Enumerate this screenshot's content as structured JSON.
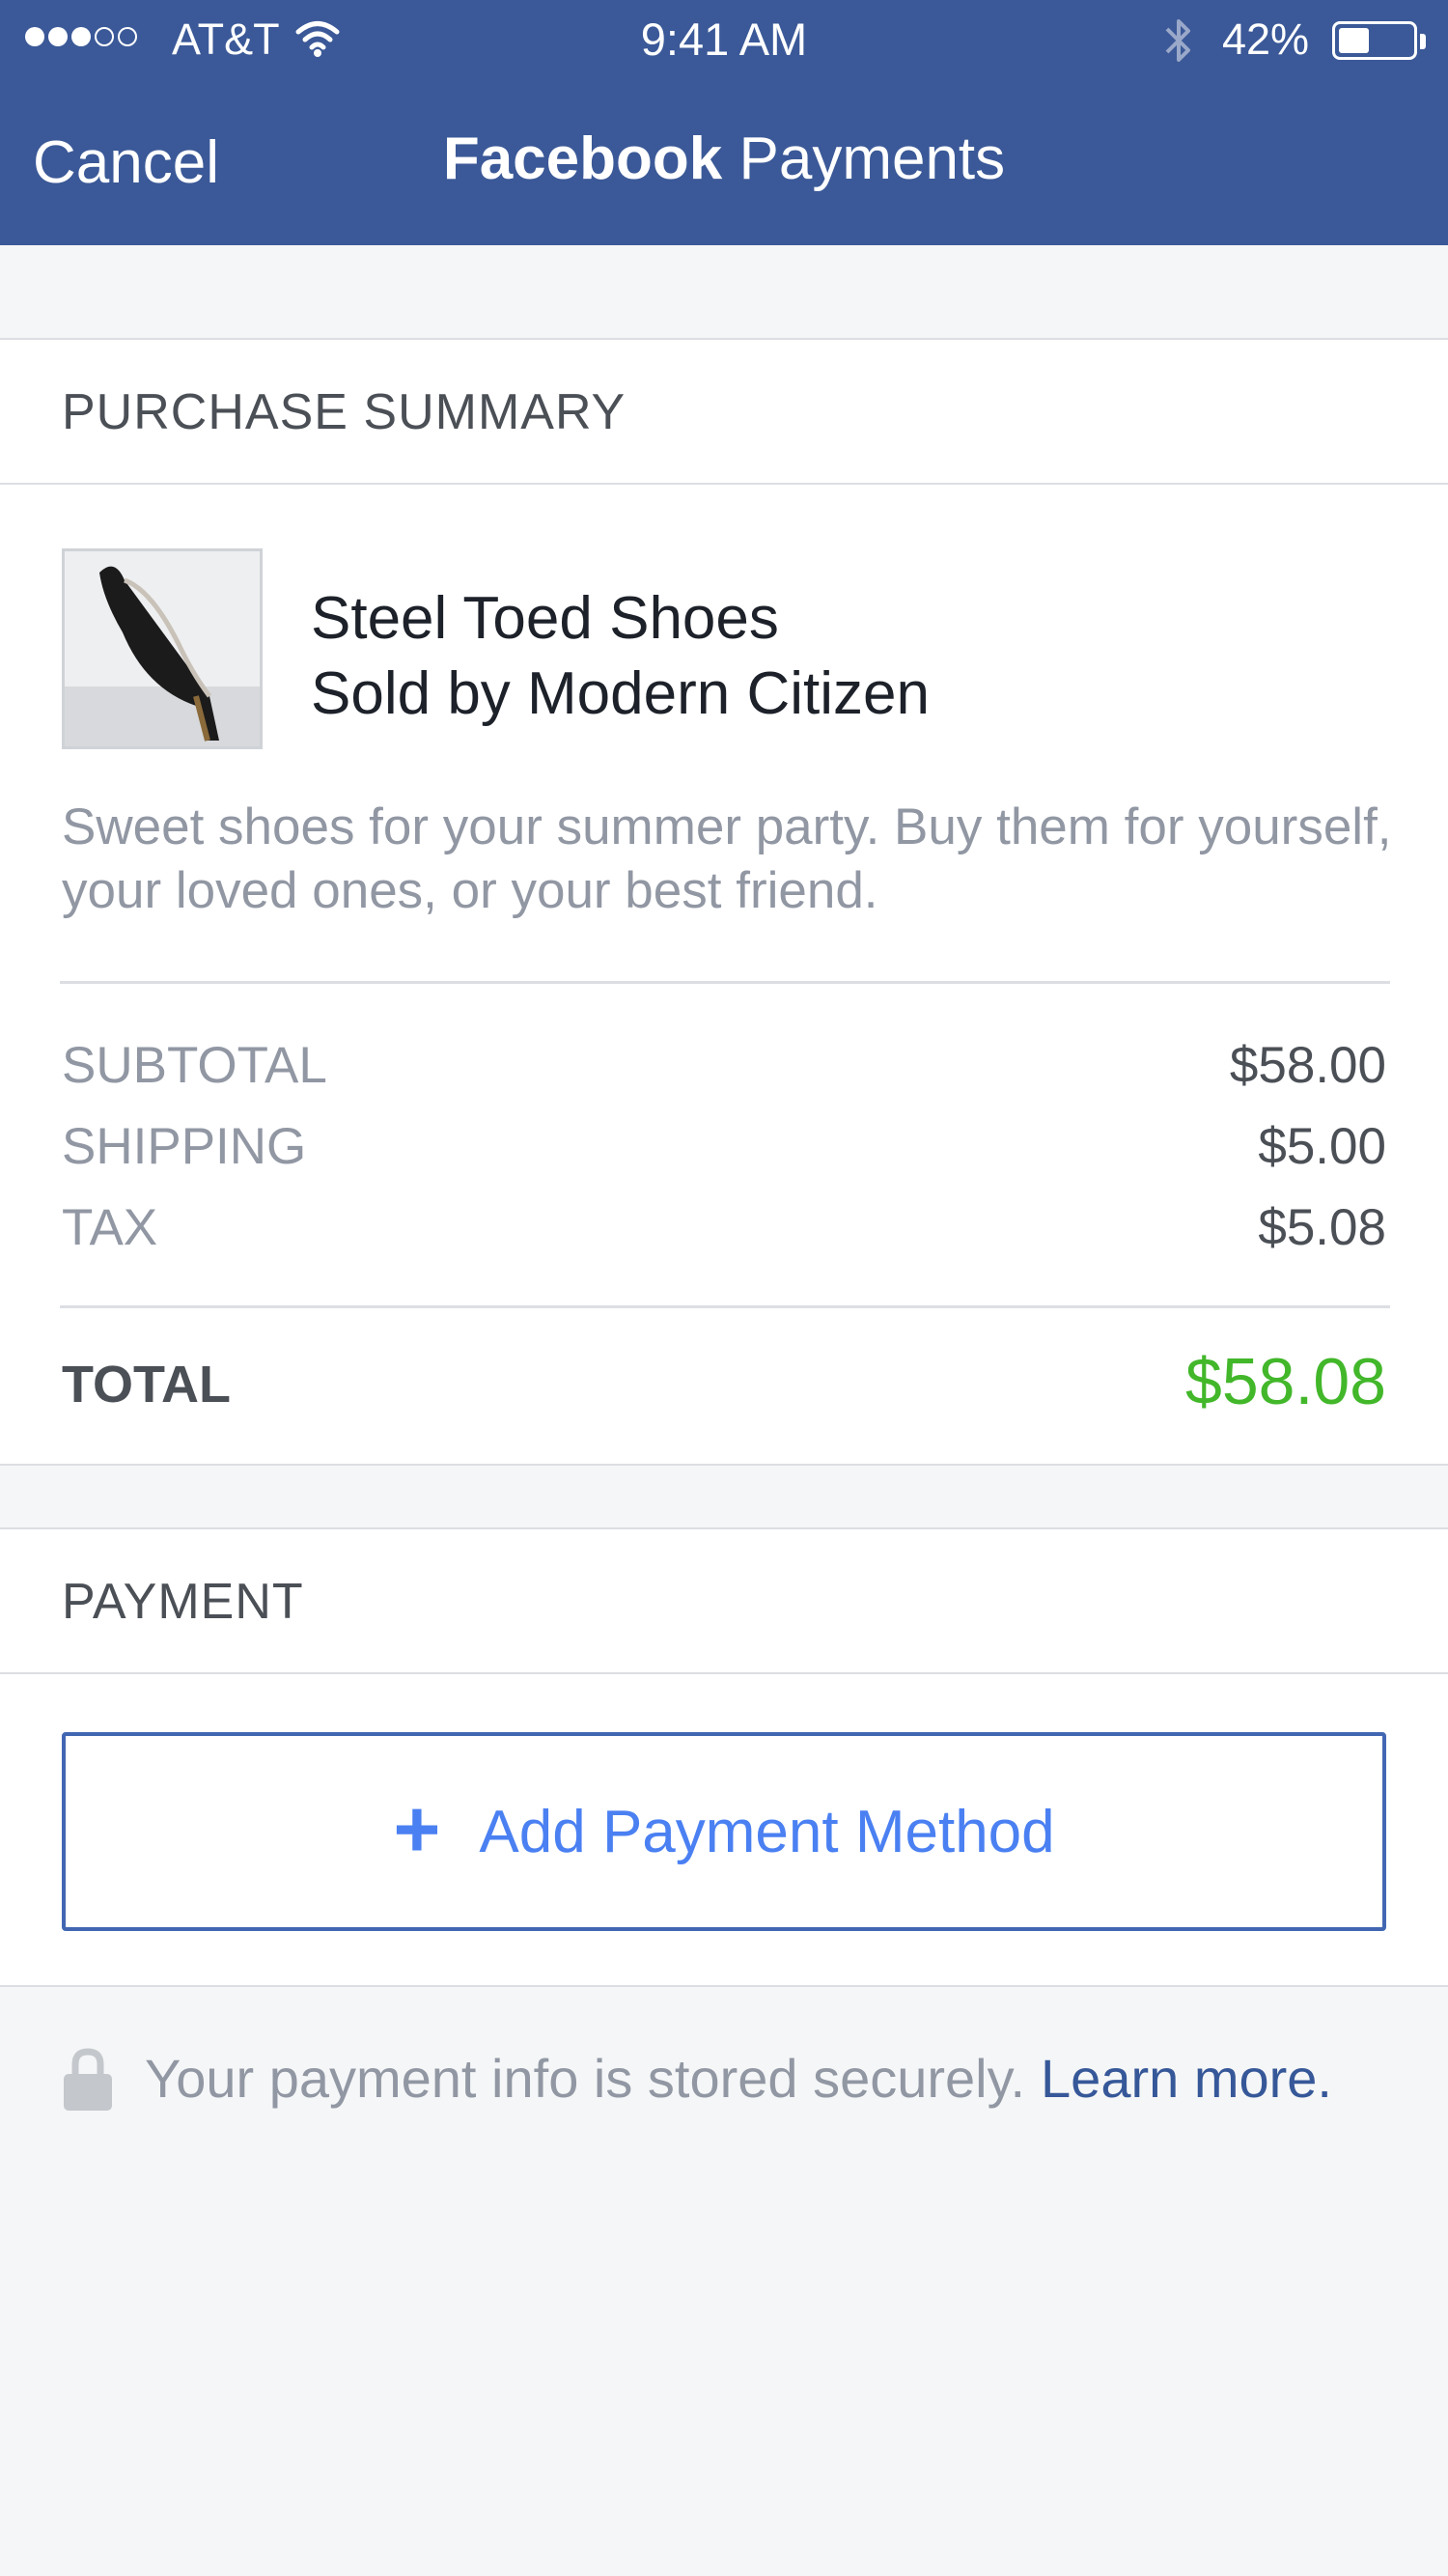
{
  "status_bar": {
    "carrier": "AT&T",
    "time": "9:41 AM",
    "battery_percent": "42%",
    "battery_level": 0.42,
    "signal_bars_filled": 3,
    "signal_bars_total": 5
  },
  "nav": {
    "cancel_label": "Cancel",
    "title_brand": "Facebook",
    "title_rest": "Payments",
    "background_color": "#3b5998"
  },
  "summary": {
    "section_title": "PURCHASE SUMMARY",
    "item": {
      "name": "Steel Toed Shoes",
      "seller": "Sold by Modern Citizen",
      "description": "Sweet shoes for your summer party. Buy them for yourself, your loved ones, or your best friend."
    },
    "lines": [
      {
        "label": "SUBTOTAL",
        "value": "$58.00"
      },
      {
        "label": "SHIPPING",
        "value": "$5.00"
      },
      {
        "label": "TAX",
        "value": "$5.08"
      }
    ],
    "total_label": "TOTAL",
    "total_value": "$58.08",
    "total_color": "#42b72a"
  },
  "payment": {
    "section_title": "PAYMENT",
    "add_button_label": "Add Payment Method",
    "add_button_icon": "plus-icon",
    "accent_color": "#4a80f2"
  },
  "footer": {
    "secure_text": "Your payment info is stored securely.",
    "learn_more_label": "Learn more.",
    "lock_icon": "lock-icon"
  }
}
